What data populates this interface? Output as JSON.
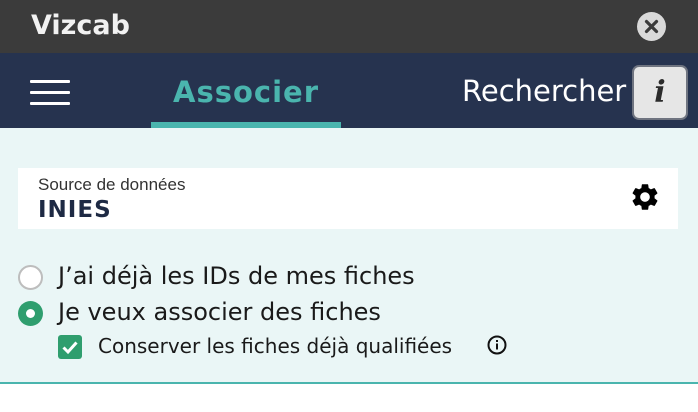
{
  "window": {
    "title": "Vizcab",
    "close_icon": "close-icon"
  },
  "nav": {
    "menu_icon": "hamburger-menu-icon",
    "tabs": [
      {
        "label": "Associer",
        "active": true
      },
      {
        "label": "Rechercher",
        "active": false
      }
    ],
    "info_button": {
      "icon": "info-icon",
      "glyph": "i"
    }
  },
  "source": {
    "label": "Source de données",
    "value": "INIES",
    "settings_icon": "gear-icon"
  },
  "options": [
    {
      "label": "J’ai déjà les IDs de mes fiches",
      "selected": false
    },
    {
      "label": "Je veux associer des fiches",
      "selected": true
    }
  ],
  "keep_qualified": {
    "label": "Conserver les fiches déjà qualifiées",
    "checked": true,
    "help_icon": "info-circle-icon"
  },
  "colors": {
    "titlebar": "#3b3b3b",
    "navbar": "#26334f",
    "accent": "#4ab5ae",
    "selected_green": "#2f9e6e",
    "panel_background": "#eaf6f6"
  }
}
